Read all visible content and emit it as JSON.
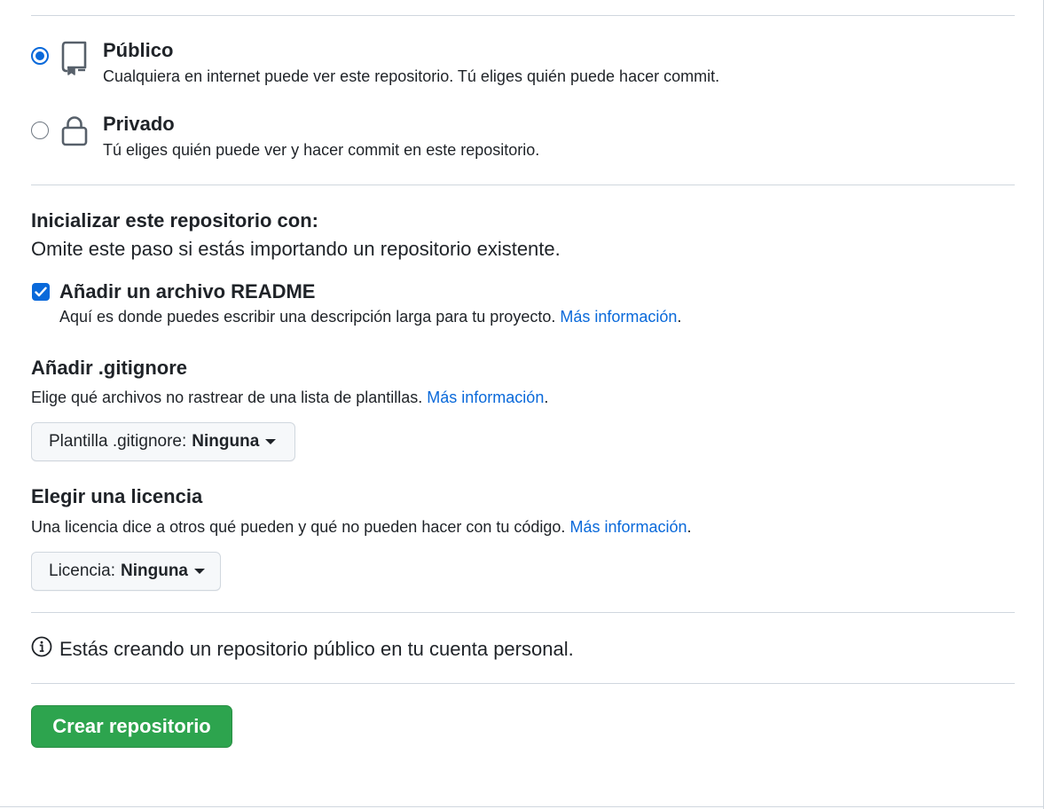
{
  "visibility": {
    "public": {
      "title": "Público",
      "description": "Cualquiera en internet puede ver este repositorio. Tú eliges quién puede hacer commit.",
      "selected": true
    },
    "private": {
      "title": "Privado",
      "description": "Tú eliges quién puede ver y hacer commit en este repositorio.",
      "selected": false
    }
  },
  "initialize": {
    "title": "Inicializar este repositorio con:",
    "note": "Omite este paso si estás importando un repositorio existente.",
    "readme": {
      "label": "Añadir un archivo README",
      "checked": true,
      "description": "Aquí es donde puedes escribir una descripción larga para tu proyecto.",
      "link": "Más información",
      "link_suffix": "."
    }
  },
  "gitignore": {
    "title": "Añadir .gitignore",
    "description": "Elige qué archivos no rastrear de una lista de plantillas.",
    "link": "Más información",
    "link_suffix": ".",
    "dropdown_label": "Plantilla .gitignore:",
    "dropdown_value": "Ninguna"
  },
  "license": {
    "title": "Elegir una licencia",
    "description": "Una licencia dice a otros qué pueden y qué no pueden hacer con tu código.",
    "link": "Más información",
    "link_suffix": ".",
    "dropdown_label": "Licencia:",
    "dropdown_value": "Ninguna"
  },
  "info": {
    "text": "Estás creando un repositorio público en tu cuenta personal.",
    "icon": "info-icon"
  },
  "submit": {
    "label": "Crear repositorio"
  },
  "colors": {
    "accent": "#0969da",
    "primary_button": "#2da44e",
    "border": "#d0d7de",
    "text": "#1f2328"
  }
}
